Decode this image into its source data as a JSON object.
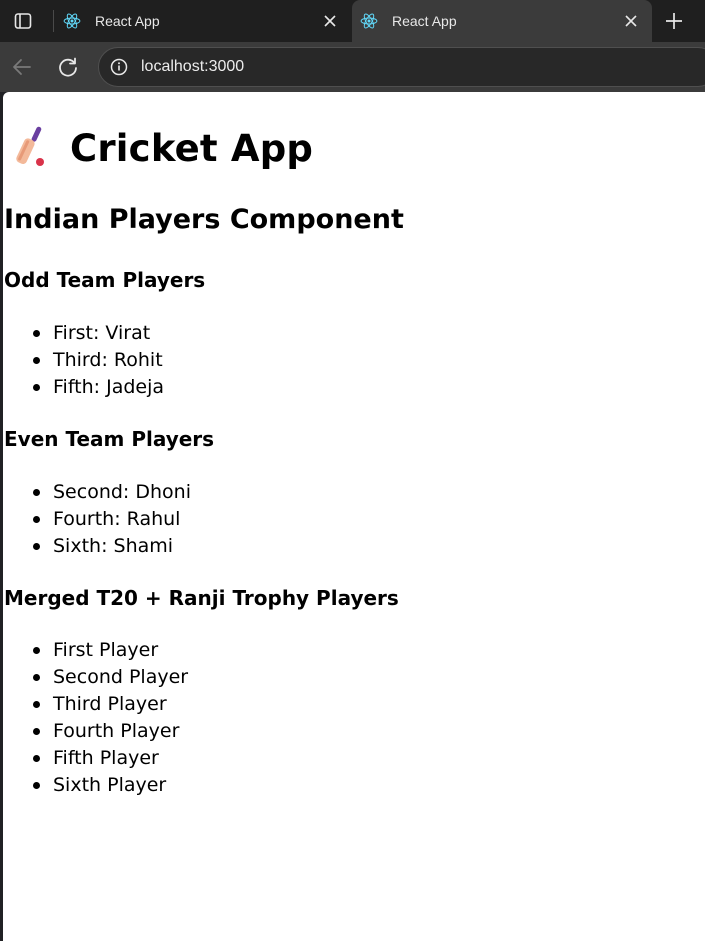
{
  "browser": {
    "tabs": [
      {
        "title": "React App",
        "active": false
      },
      {
        "title": "React App",
        "active": true
      }
    ],
    "address_bar": {
      "url": "localhost:3000"
    }
  },
  "page": {
    "app_title": "Cricket App",
    "app_icon": "cricket-bat-icon",
    "component_heading": "Indian Players Component",
    "odd_section": {
      "heading": "Odd Team Players",
      "players": [
        "First: Virat",
        "Third: Rohit",
        "Fifth: Jadeja"
      ]
    },
    "even_section": {
      "heading": "Even Team Players",
      "players": [
        "Second: Dhoni",
        "Fourth: Rahul",
        "Sixth: Shami"
      ]
    },
    "merged_section": {
      "heading": "Merged T20 + Ranji Trophy Players",
      "players": [
        "First Player",
        "Second Player",
        "Third Player",
        "Fourth Player",
        "Fifth Player",
        "Sixth Player"
      ]
    }
  },
  "colors": {
    "tabstrip_bg": "#1f1f1f",
    "toolbar_bg": "#3b3b3b",
    "react_logo": "#61dafb"
  }
}
